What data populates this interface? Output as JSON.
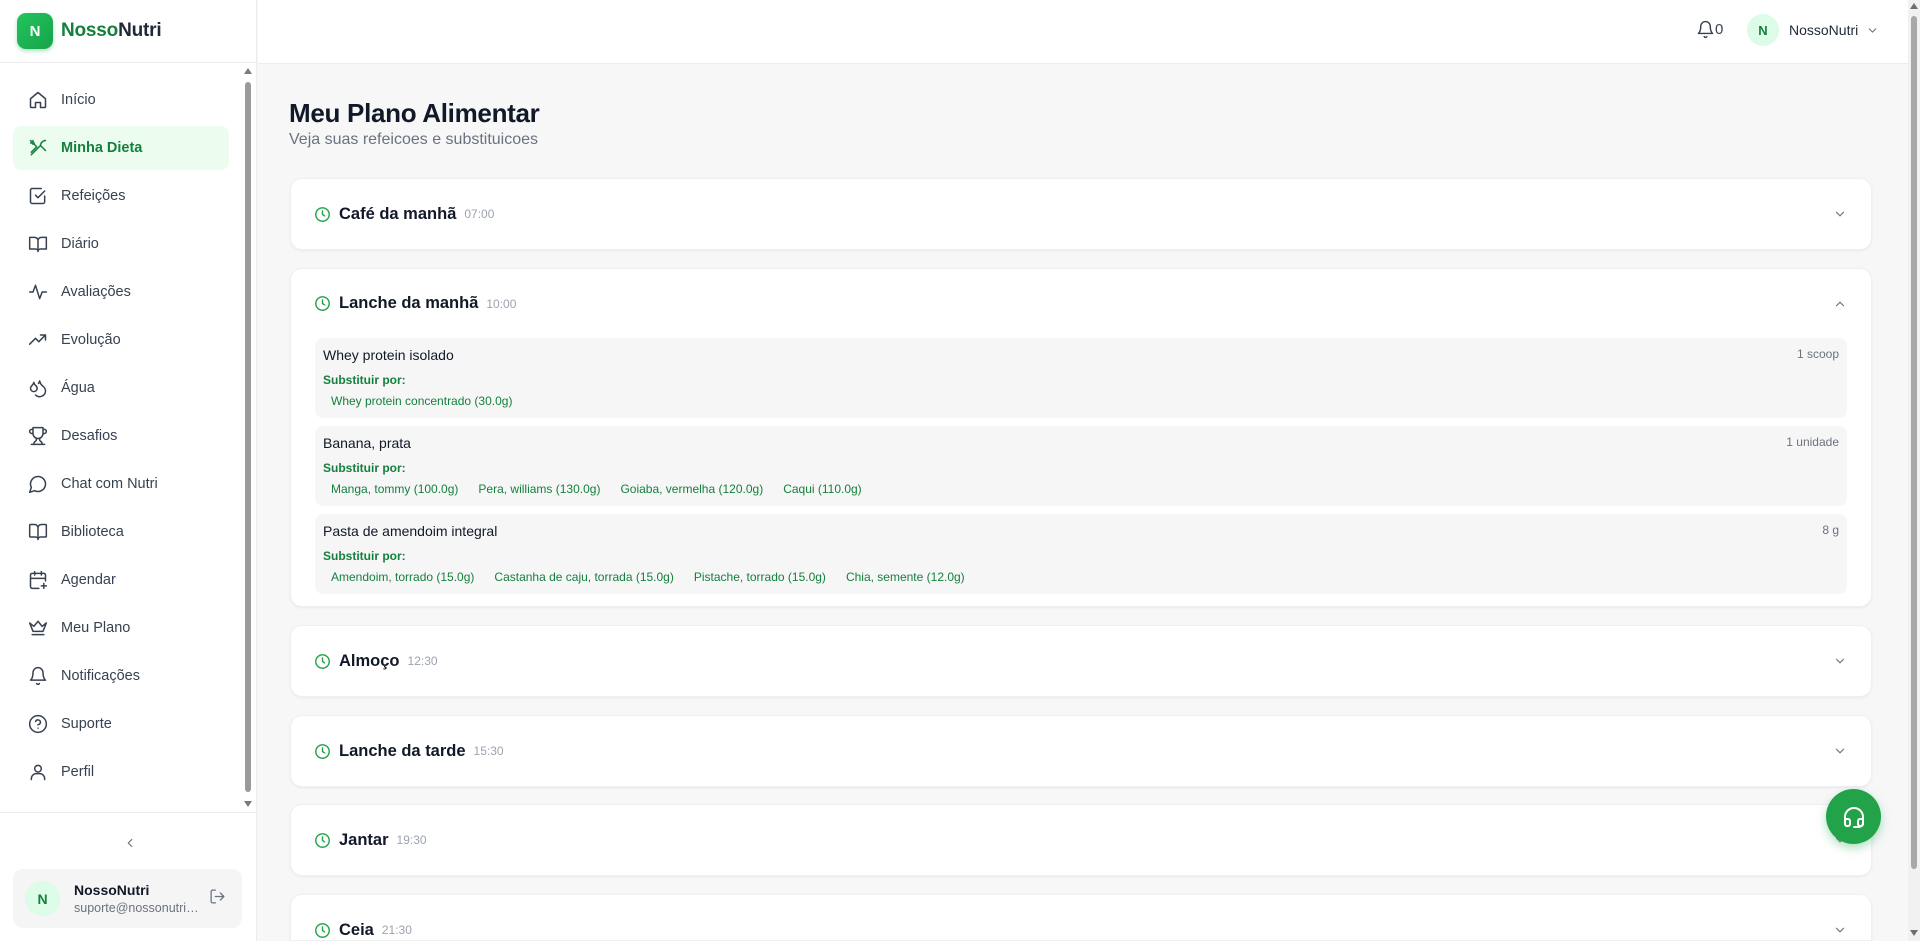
{
  "brand": {
    "logo_letter": "N",
    "name_part1": "Nosso",
    "name_part2": "Nutri"
  },
  "sidebar": {
    "items": [
      {
        "label": "Início",
        "icon": "home-icon"
      },
      {
        "label": "Minha Dieta",
        "icon": "utensils-icon",
        "active": true
      },
      {
        "label": "Refeições",
        "icon": "checkbox-icon"
      },
      {
        "label": "Diário",
        "icon": "book-open-icon"
      },
      {
        "label": "Avaliações",
        "icon": "activity-icon"
      },
      {
        "label": "Evolução",
        "icon": "trending-up-icon"
      },
      {
        "label": "Água",
        "icon": "droplets-icon"
      },
      {
        "label": "Desafios",
        "icon": "trophy-icon"
      },
      {
        "label": "Chat com Nutri",
        "icon": "message-circle-icon"
      },
      {
        "label": "Biblioteca",
        "icon": "book-icon"
      },
      {
        "label": "Agendar",
        "icon": "calendar-plus-icon"
      },
      {
        "label": "Meu Plano",
        "icon": "crown-icon"
      },
      {
        "label": "Notificações",
        "icon": "bell-icon"
      },
      {
        "label": "Suporte",
        "icon": "help-circle-icon"
      },
      {
        "label": "Perfil",
        "icon": "user-icon"
      }
    ],
    "user": {
      "initial": "N",
      "name": "NossoNutri",
      "email": "suporte@nossonutri.com"
    }
  },
  "topbar": {
    "notification_count": "0",
    "user_initial": "N",
    "user_name": "NossoNutri"
  },
  "page": {
    "title": "Meu Plano Alimentar",
    "subtitle": "Veja suas refeicoes e substituicoes"
  },
  "meals": [
    {
      "name": "Café da manhã",
      "time": "07:00",
      "expanded": false
    },
    {
      "name": "Lanche da manhã",
      "time": "10:00",
      "expanded": true,
      "foods": [
        {
          "name": "Whey protein isolado",
          "qty": "1 scoop",
          "subst_label": "Substituir por:",
          "substitutes": [
            "Whey protein concentrado (30.0g)"
          ]
        },
        {
          "name": "Banana, prata",
          "qty": "1 unidade",
          "subst_label": "Substituir por:",
          "substitutes": [
            "Manga, tommy (100.0g)",
            "Pera, williams (130.0g)",
            "Goiaba, vermelha (120.0g)",
            "Caqui (110.0g)"
          ]
        },
        {
          "name": "Pasta de amendoim integral",
          "qty": "8 g",
          "subst_label": "Substituir por:",
          "substitutes": [
            "Amendoim, torrado (15.0g)",
            "Castanha de caju, torrada (15.0g)",
            "Pistache, torrado (15.0g)",
            "Chia, semente (12.0g)"
          ]
        }
      ]
    },
    {
      "name": "Almoço",
      "time": "12:30",
      "expanded": false
    },
    {
      "name": "Lanche da tarde",
      "time": "15:30",
      "expanded": false
    },
    {
      "name": "Jantar",
      "time": "19:30",
      "expanded": false
    },
    {
      "name": "Ceia",
      "time": "21:30",
      "expanded": false
    }
  ],
  "colors": {
    "accent": "#22a34a",
    "accent_dark": "#15803d",
    "active_bg": "#ecfdf0"
  }
}
